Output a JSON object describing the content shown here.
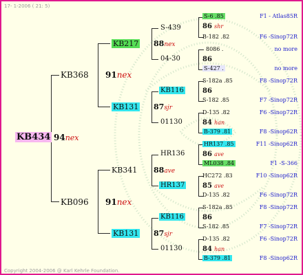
{
  "header": "17-  1-2006 ( 21: 5)",
  "footer": "Copyright 2004-2006 @ Karl Kehrle Foundation.",
  "root": {
    "name": "KB434",
    "score": "94",
    "tag": "nex"
  },
  "sire": {
    "name": "KB368",
    "score": "91",
    "tag": "nex"
  },
  "dam": {
    "name": "KB096",
    "score": "91",
    "tag": "nex"
  },
  "gen3": [
    {
      "name": "KB217",
      "score": "88",
      "tag": "nex"
    },
    {
      "name": "KB131",
      "score": "87",
      "tag": "sjr"
    },
    {
      "name": "KB341",
      "score": "88",
      "tag": "ave"
    },
    {
      "name": "KB131",
      "score": "87",
      "tag": "sjr"
    }
  ],
  "gen4": [
    {
      "name": "S-439"
    },
    {
      "name": "04-30"
    },
    {
      "name": "KB116"
    },
    {
      "name": "01130"
    },
    {
      "name": "HR136"
    },
    {
      "name": "HR137"
    },
    {
      "name": "KB116"
    },
    {
      "name": "01130"
    }
  ],
  "gen5": [
    {
      "top": "S-6 .85",
      "num": "86",
      "tag": "shr",
      "bot": "B-182 .82",
      "r1": "F1 - Atlas85R",
      "r2": "F6 -Sinop72R"
    },
    {
      "top": "8086 .",
      "num": "86",
      "tag": "",
      "bot": "S-427 .",
      "r1": "no more",
      "r2": "no more"
    },
    {
      "top": "S-182a .85",
      "num": "86",
      "tag": "",
      "bot": "S-182 .85",
      "r1": "F8 -Sinop72R",
      "r2": "F7 -Sinop72R"
    },
    {
      "top": "D-135 .82",
      "num": "84",
      "tag": "han",
      "bot": "B-379 .81",
      "r1": "F6 -Sinop72R",
      "r2": "F8 -Sinop62R"
    },
    {
      "top": "HR137 .85",
      "num": "86",
      "tag": "ave",
      "bot": "ML038 .84",
      "r1": "F11 -Sinop62R",
      "r2": "F1 -S-366"
    },
    {
      "top": "HC272 .83",
      "num": "85",
      "tag": "ave",
      "bot": "D-135 .82",
      "r1": "F10 -Sinop62R",
      "r2": "F6 -Sinop72R"
    },
    {
      "top": "S-182a .85",
      "num": "86",
      "tag": "",
      "bot": "S-182 .85",
      "r1": "F8 -Sinop72R",
      "r2": "F7 -Sinop72R"
    },
    {
      "top": "D-135 .82",
      "num": "84",
      "tag": "han",
      "bot": "B-379 .81",
      "r1": "F6 -Sinop72R",
      "r2": "F8 -Sinop62R"
    }
  ],
  "colors": {
    "frame": "#e0188e",
    "background": "#ffffe8",
    "pink": "#f7b8f0",
    "green": "#55dd55",
    "cyan": "#33e6ee",
    "red": "#cc1010",
    "blue": "#1a1acc"
  }
}
